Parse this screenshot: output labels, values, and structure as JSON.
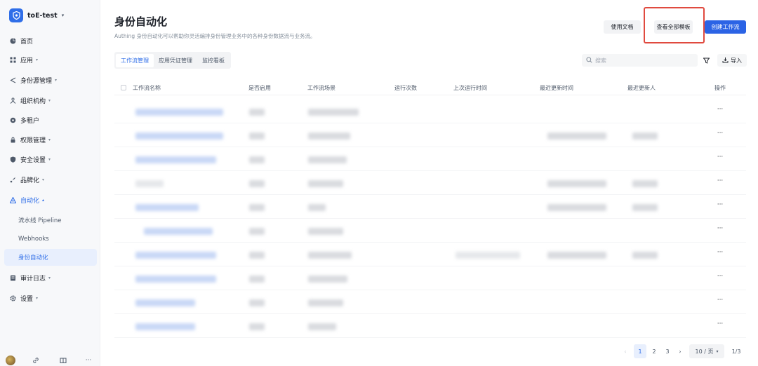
{
  "sidebar": {
    "tenant_name": "toE-test",
    "items": [
      {
        "label": "首页",
        "icon": "pie-chart-icon",
        "caret": ""
      },
      {
        "label": "应用",
        "icon": "grid-icon",
        "caret": "▾"
      },
      {
        "label": "身份源管理",
        "icon": "share-icon",
        "caret": "▾"
      },
      {
        "label": "组织机构",
        "icon": "org-icon",
        "caret": "▾"
      },
      {
        "label": "多租户",
        "icon": "globe-icon",
        "caret": ""
      },
      {
        "label": "权限管理",
        "icon": "lock-icon",
        "caret": "▾"
      },
      {
        "label": "安全设置",
        "icon": "shield-icon",
        "caret": "▾"
      },
      {
        "label": "品牌化",
        "icon": "brush-icon",
        "caret": "▾"
      },
      {
        "label": "自动化",
        "icon": "automation-icon",
        "caret": "▴"
      },
      {
        "label": "流水线 Pipeline",
        "icon": "",
        "caret": ""
      },
      {
        "label": "Webhooks",
        "icon": "",
        "caret": ""
      },
      {
        "label": "身份自动化",
        "icon": "",
        "caret": ""
      },
      {
        "label": "审计日志",
        "icon": "log-icon",
        "caret": "▾"
      },
      {
        "label": "设置",
        "icon": "gear-icon",
        "caret": "▾"
      }
    ]
  },
  "page": {
    "title": "身份自动化",
    "description": "Authing 身份自动化可以帮助你灵活编排身份管理业务中的各种身份数据流与业务流。"
  },
  "actions": {
    "docs_label": "使用文档",
    "templates_label": "查看全部模板",
    "create_label": "创建工作流"
  },
  "tabs": [
    "工作流管理",
    "应用凭证管理",
    "监控看板"
  ],
  "toolbar": {
    "search_placeholder": "搜索",
    "import_label": "导入"
  },
  "table": {
    "columns": [
      "工作流名称",
      "是否启用",
      "工作流场景",
      "运行次数",
      "上次运行时间",
      "最近更新时间",
      "最近更新人",
      "操作"
    ],
    "row_action": "···"
  },
  "pagination": {
    "pages": [
      "1",
      "2",
      "3"
    ],
    "current": "1",
    "page_size": "10 / 页",
    "total": "1/3"
  },
  "colors": {
    "primary": "#2b63e5",
    "highlight_border": "#e04a3f",
    "sidebar_bg": "#f7f8fa"
  }
}
